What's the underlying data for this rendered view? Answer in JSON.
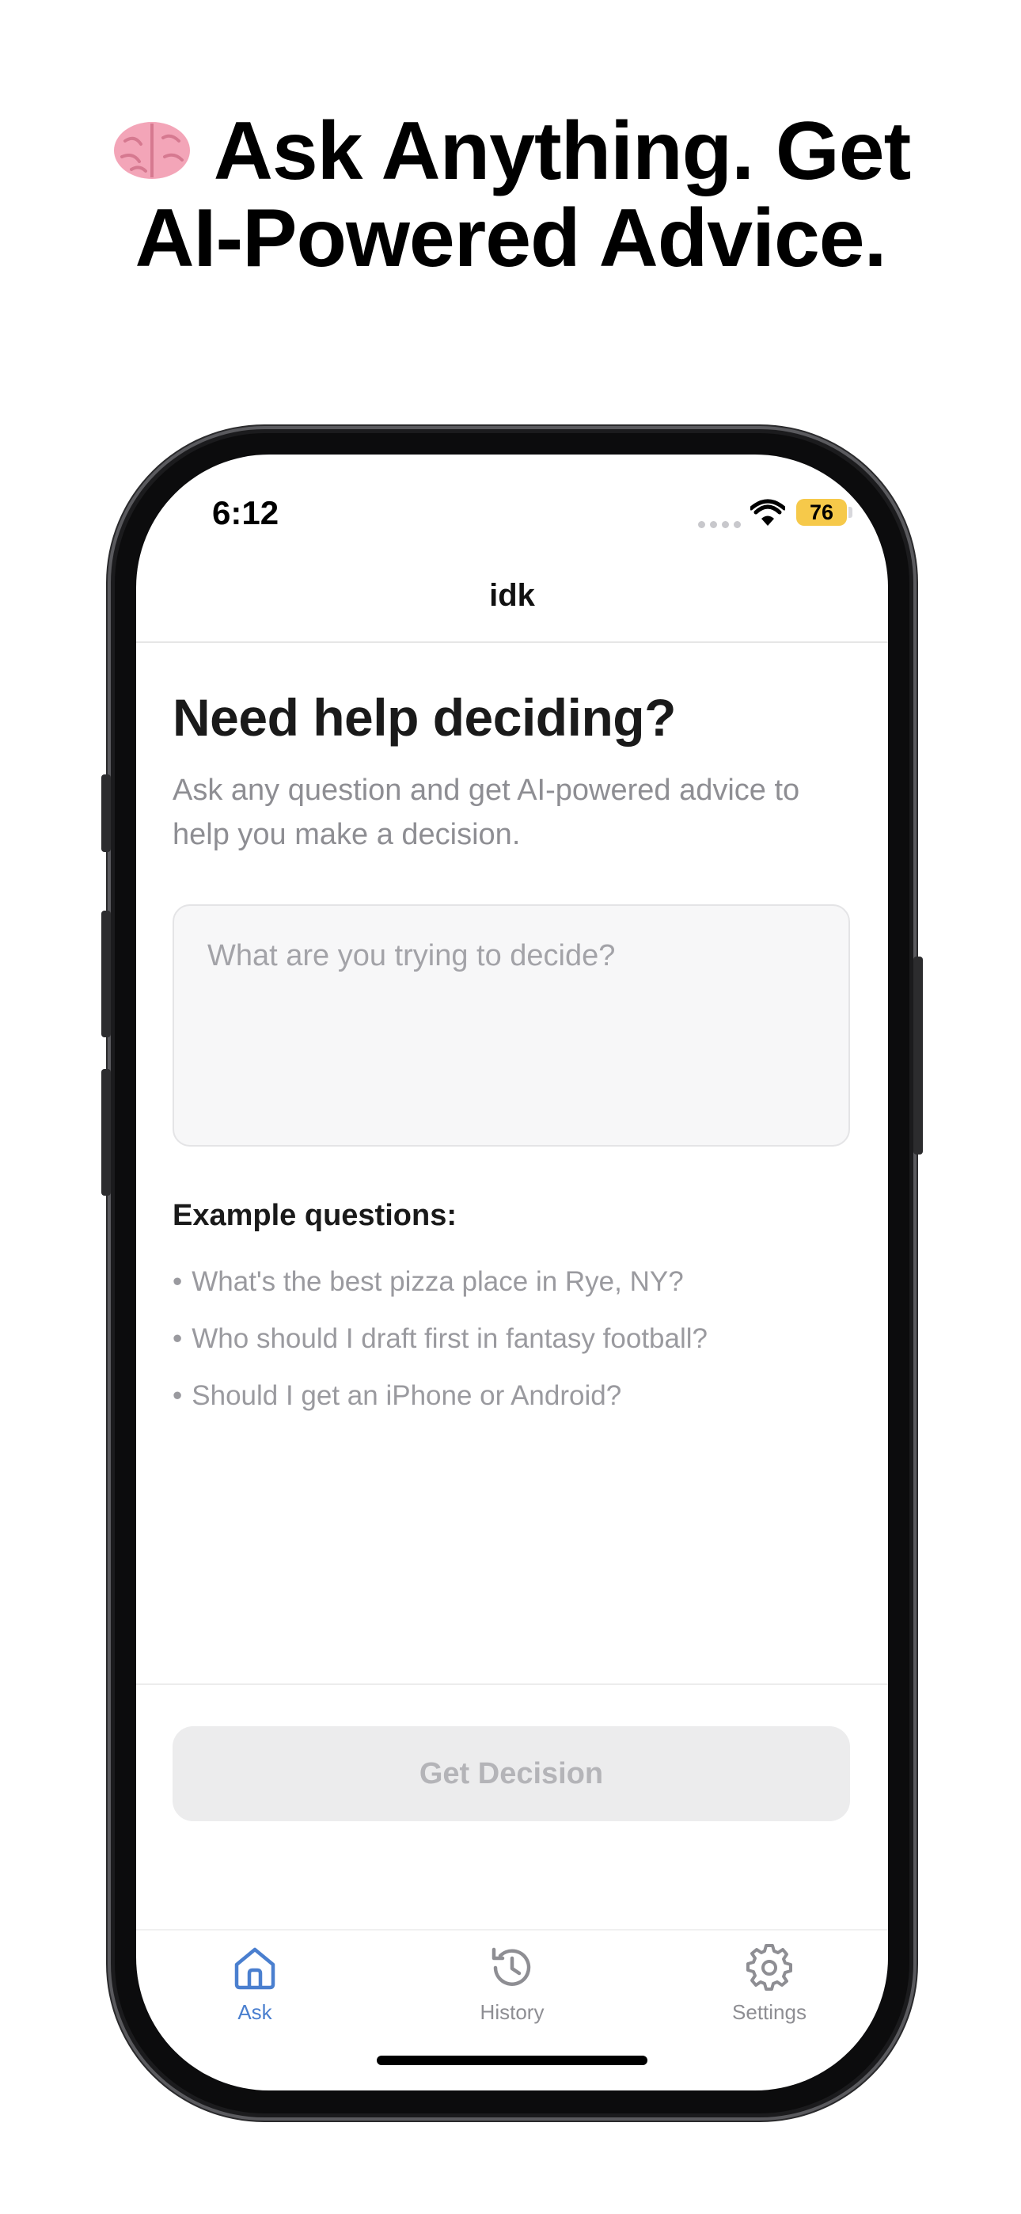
{
  "headline": {
    "line1": "Ask Anything. Get",
    "line2": "AI-Powered Advice.",
    "emoji_icon": "brain-icon"
  },
  "status_bar": {
    "time": "6:12",
    "battery": "76",
    "battery_color": "#f6c94a"
  },
  "nav": {
    "title": "idk"
  },
  "main": {
    "title": "Need help deciding?",
    "subtitle": "Ask any question and get AI-powered advice to help you make a decision.",
    "input": {
      "value": "",
      "placeholder": "What are you trying to decide?"
    },
    "examples_heading": "Example questions:",
    "bullet": "•",
    "examples": [
      "What's the best pizza place in Rye, NY?",
      "Who should I draft first in fantasy football?",
      "Should I get an iPhone or Android?"
    ],
    "submit_label": "Get Decision"
  },
  "tabs": [
    {
      "label": "Ask",
      "icon": "home-icon",
      "active": true
    },
    {
      "label": "History",
      "icon": "history-icon",
      "active": false
    },
    {
      "label": "Settings",
      "icon": "gear-icon",
      "active": false
    }
  ],
  "colors": {
    "accent": "#4a7fcf",
    "inactive": "#8e8e93",
    "disabled_button_bg": "#ececed"
  }
}
